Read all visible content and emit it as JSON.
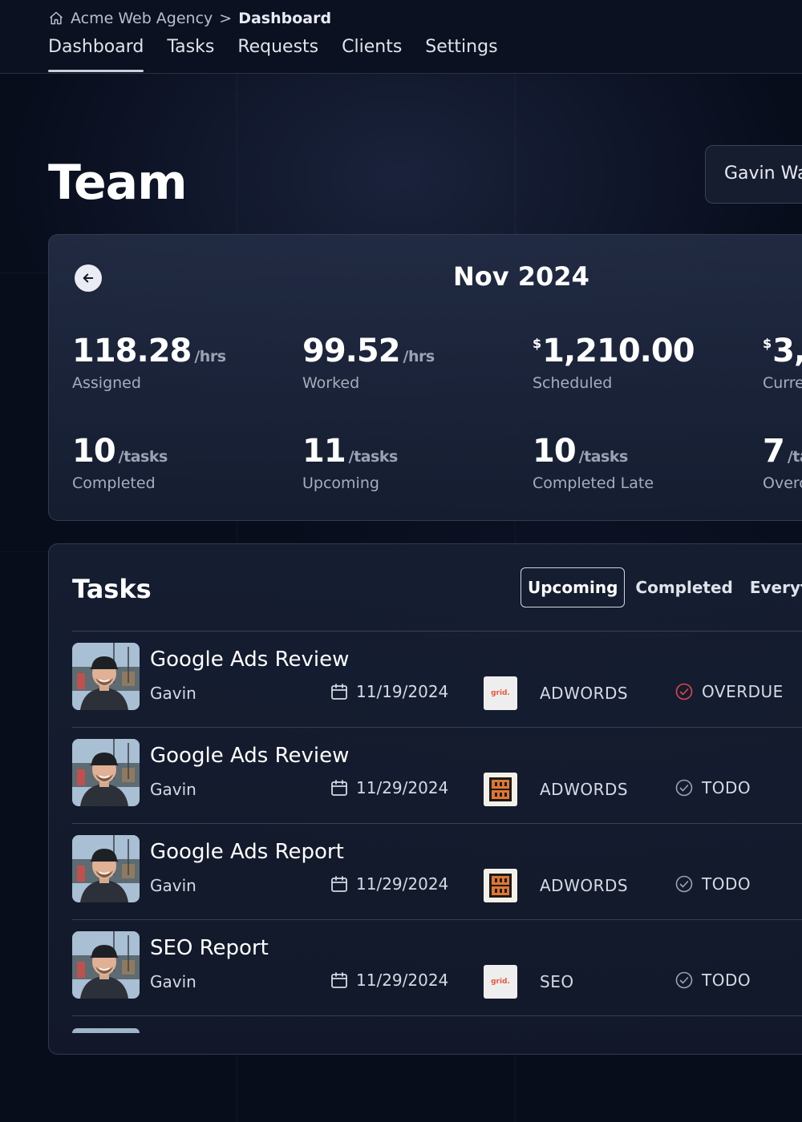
{
  "breadcrumb": {
    "org": "Acme Web Agency",
    "separator": ">",
    "current": "Dashboard"
  },
  "nav": {
    "tabs": [
      {
        "label": "Dashboard",
        "active": true
      },
      {
        "label": "Tasks"
      },
      {
        "label": "Requests"
      },
      {
        "label": "Clients"
      },
      {
        "label": "Settings"
      }
    ]
  },
  "page": {
    "title": "Team",
    "user_select": "Gavin Wa"
  },
  "stats": {
    "month": "Nov 2024",
    "items": [
      {
        "value": "118.28",
        "unit": "/hrs",
        "label": "Assigned"
      },
      {
        "value": "99.52",
        "unit": "/hrs",
        "label": "Worked"
      },
      {
        "currency": "$",
        "value": "1,210.00",
        "label": "Scheduled"
      },
      {
        "currency": "$",
        "value": "3,",
        "label": "Curre"
      },
      {
        "value": "10",
        "unit": "/tasks",
        "label": "Completed"
      },
      {
        "value": "11",
        "unit": "/tasks",
        "label": "Upcoming"
      },
      {
        "value": "10",
        "unit": "/tasks",
        "label": "Completed Late"
      },
      {
        "value": "7",
        "unit": "/ta",
        "label": "Overc"
      }
    ]
  },
  "tasks": {
    "title": "Tasks",
    "filters": [
      {
        "label": "Upcoming",
        "active": true
      },
      {
        "label": "Completed"
      },
      {
        "label": "Everyth"
      }
    ],
    "rows": [
      {
        "name": "Google Ads Review",
        "assignee": "Gavin",
        "due": "11/19/2024",
        "client_logo": "grid",
        "logo_text": "grid.",
        "category": "ADWORDS",
        "status": "OVERDUE",
        "status_color": "#e0464a"
      },
      {
        "name": "Google Ads Review",
        "assignee": "Gavin",
        "due": "11/29/2024",
        "client_logo": "bigbold",
        "category": "ADWORDS",
        "status": "TODO",
        "status_color": "#9aa3b5"
      },
      {
        "name": "Google Ads Report",
        "assignee": "Gavin",
        "due": "11/29/2024",
        "client_logo": "bigbold",
        "category": "ADWORDS",
        "status": "TODO",
        "status_color": "#9aa3b5"
      },
      {
        "name": "SEO Report",
        "assignee": "Gavin",
        "due": "11/29/2024",
        "client_logo": "grid",
        "logo_text": "grid.",
        "category": "SEO",
        "status": "TODO",
        "status_color": "#9aa3b5"
      }
    ]
  }
}
